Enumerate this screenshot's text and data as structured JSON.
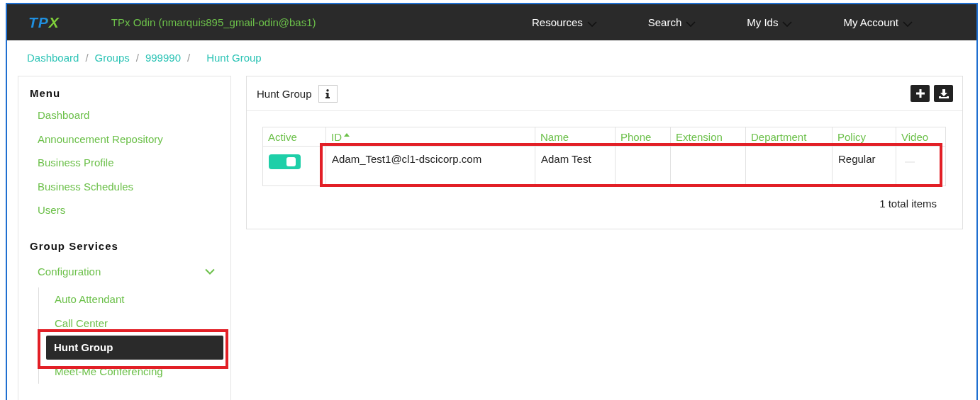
{
  "header": {
    "logo": "TPX",
    "user": "TPx Odin (nmarquis895_gmail-odin@bas1)",
    "menus": [
      {
        "label": "Resources"
      },
      {
        "label": "Search"
      },
      {
        "label": "My Ids"
      },
      {
        "label": "My Account"
      }
    ]
  },
  "breadcrumb": [
    "Dashboard",
    "/",
    "Groups",
    "/",
    "999990",
    "/",
    "Hunt Group"
  ],
  "sidebar": {
    "title": "Menu",
    "items": [
      {
        "label": "Dashboard",
        "selected": false
      },
      {
        "label": "Announcement Repository",
        "selected": false
      },
      {
        "label": "Business Profile",
        "selected": false
      },
      {
        "label": "Business Schedules",
        "selected": false
      },
      {
        "label": "Users",
        "selected": false
      }
    ],
    "section": "Group Services",
    "group": {
      "label": "Configuration",
      "expanded": true,
      "children": [
        {
          "label": "Auto Attendant",
          "selected": false
        },
        {
          "label": "Call Center",
          "selected": false
        },
        {
          "label": "Hunt Group",
          "selected": true
        },
        {
          "label": "Meet-Me Conferencing",
          "selected": false
        }
      ]
    }
  },
  "panel": {
    "title": "Hunt Group",
    "columns": [
      "Active",
      "ID",
      "Name",
      "Phone",
      "Extension",
      "Department",
      "Policy",
      "Video"
    ],
    "rows": [
      {
        "active": true,
        "id": "Adam_Test1@cl1-dscicorp.com",
        "name": "Adam Test",
        "policy": "Regular"
      }
    ],
    "footer": "1 total items"
  }
}
